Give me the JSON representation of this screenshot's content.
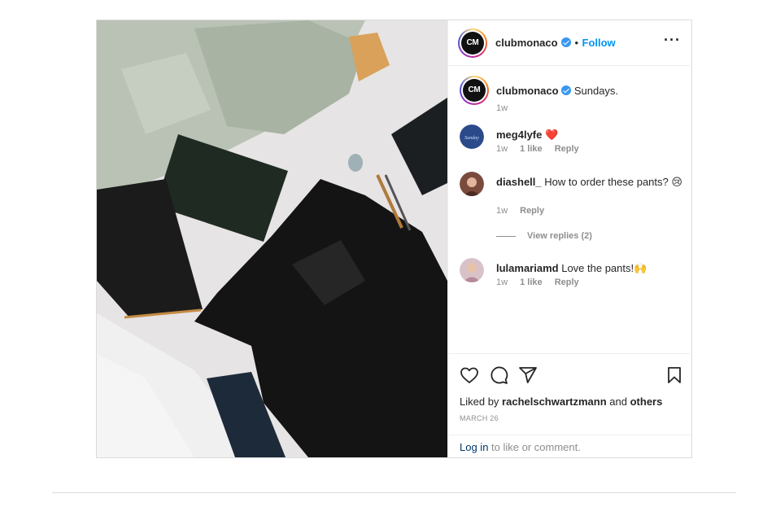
{
  "post": {
    "author": {
      "username": "clubmonaco",
      "avatar_text": "CM",
      "verified": true
    },
    "follow_label": "Follow",
    "separator": "•",
    "more_icon": "ellipsis-icon",
    "caption": {
      "username": "clubmonaco",
      "text": "Sundays.",
      "time": "1w"
    },
    "comments": [
      {
        "username": "meg4lyfe",
        "text": "❤️",
        "time": "1w",
        "likes": "1 like",
        "reply_label": "Reply"
      },
      {
        "username": "diashell_",
        "text": "How to order these pants? 😢",
        "time": "1w",
        "reply_label": "Reply"
      },
      {
        "username": "lulamariamd",
        "text": "Love the pants!🙌",
        "time": "1w",
        "likes": "1 like",
        "reply_label": "Reply"
      }
    ],
    "view_replies_label": "View replies (2)",
    "icons": [
      "heart-icon",
      "comment-icon",
      "share-icon",
      "bookmark-icon"
    ],
    "liked_by_prefix": "Liked by",
    "liked_by_user": "rachelschwartzmann",
    "liked_by_and": "and",
    "liked_by_others": "others",
    "date": "MARCH 26",
    "login_link": "Log in",
    "login_suffix": " to like or comment."
  },
  "colors": {
    "accent": "#0095f6",
    "verified": "#3897f0",
    "muted": "#8e8e8e",
    "border": "#dbdbdb",
    "link": "#00376b"
  }
}
